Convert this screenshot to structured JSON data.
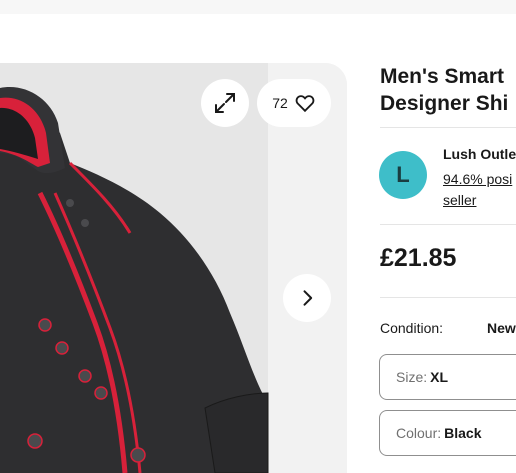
{
  "gallery": {
    "watch_count": "72",
    "icons": {
      "expand": "expand-icon",
      "watch": "heart-icon",
      "next": "chevron-right-icon"
    }
  },
  "product": {
    "title_line1": "Men's Smart",
    "title_line2": "Designer Shi"
  },
  "seller": {
    "avatar_letter": "L",
    "name": "Lush Outle",
    "feedback_line1": "94.6% posi",
    "feedback_line2": "seller"
  },
  "price": "£21.85",
  "condition": {
    "label": "Condition:",
    "value": "New"
  },
  "variations": {
    "size": {
      "label": "Size:",
      "value": "XL"
    },
    "colour": {
      "label": "Colour:",
      "value": "Black"
    }
  },
  "colors": {
    "accent": "#3ebec9",
    "shirt": "#2e2e30",
    "trim": "#d8213a"
  }
}
